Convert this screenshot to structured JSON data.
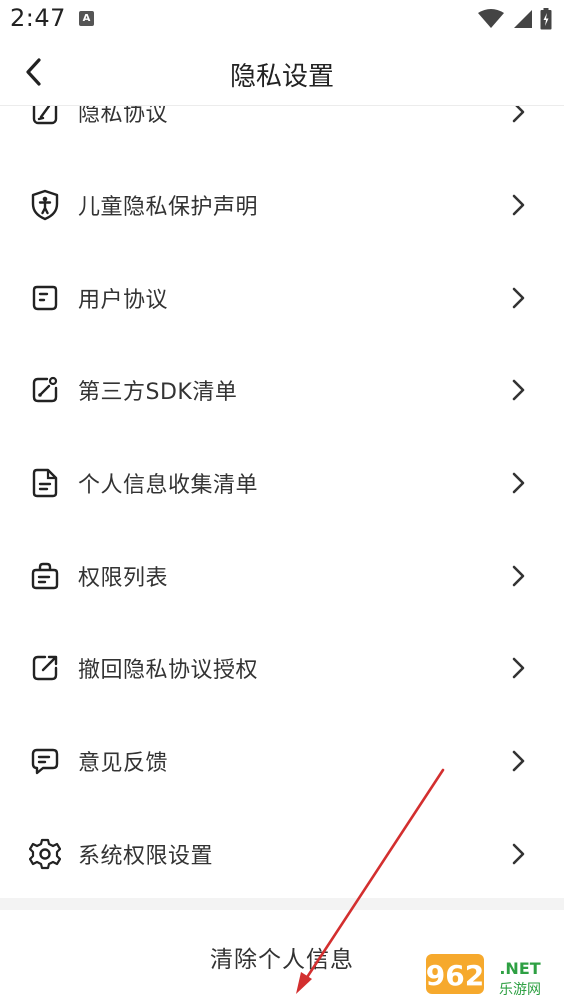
{
  "status_bar": {
    "time": "2:47",
    "notification_icon": "a-badge-icon"
  },
  "header": {
    "title": "隐私设置",
    "back_icon": "chevron-left-icon"
  },
  "menu": [
    {
      "label": "隐私协议",
      "icon": "pen-square-icon"
    },
    {
      "label": "儿童隐私保护声明",
      "icon": "shield-child-icon"
    },
    {
      "label": "用户协议",
      "icon": "document-icon"
    },
    {
      "label": "第三方SDK清单",
      "icon": "external-edit-icon"
    },
    {
      "label": "个人信息收集清单",
      "icon": "file-list-icon"
    },
    {
      "label": "权限列表",
      "icon": "bag-icon"
    },
    {
      "label": "撤回隐私协议授权",
      "icon": "share-out-icon"
    },
    {
      "label": "意见反馈",
      "icon": "chat-bubble-icon"
    },
    {
      "label": "系统权限设置",
      "icon": "gear-icon"
    }
  ],
  "footer": {
    "clear_label": "清除个人信息"
  },
  "watermark": {
    "brand": "962.NET",
    "sub": "乐游网"
  },
  "colors": {
    "arrow": "#d32f2f",
    "watermark_orange": "#f5a21b",
    "watermark_green": "#2ea043"
  }
}
